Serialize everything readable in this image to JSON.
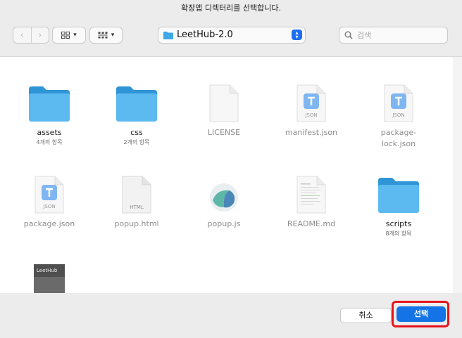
{
  "dialog": {
    "title": "확장앱 디렉터리를 선택합니다."
  },
  "toolbar": {
    "path_label": "LeetHub-2.0",
    "search_placeholder": "검색"
  },
  "files": [
    {
      "name": "assets",
      "sub": "4개의 항목",
      "kind": "folder",
      "dimmed": false
    },
    {
      "name": "css",
      "sub": "2개의 항목",
      "kind": "folder",
      "dimmed": false
    },
    {
      "name": "LICENSE",
      "sub": "",
      "kind": "blank-doc",
      "dimmed": true
    },
    {
      "name": "manifest.json",
      "sub": "",
      "kind": "json",
      "dimmed": true
    },
    {
      "name": "package-lock.json",
      "sub": "",
      "kind": "json",
      "dimmed": true
    },
    {
      "name": "package.json",
      "sub": "",
      "kind": "json",
      "dimmed": true
    },
    {
      "name": "popup.html",
      "sub": "",
      "kind": "html",
      "dimmed": true
    },
    {
      "name": "popup.js",
      "sub": "",
      "kind": "js",
      "dimmed": true
    },
    {
      "name": "README.md",
      "sub": "",
      "kind": "md",
      "dimmed": true
    },
    {
      "name": "scripts",
      "sub": "8개의 항목",
      "kind": "folder",
      "dimmed": false
    },
    {
      "name": "",
      "sub": "",
      "kind": "image",
      "dimmed": true,
      "thumb_text": "LeetHub"
    }
  ],
  "footer": {
    "cancel_label": "취소",
    "select_label": "선택"
  },
  "colors": {
    "accent": "#1473e6",
    "folder": "#3ea7e6",
    "highlight": "#e8141d"
  }
}
